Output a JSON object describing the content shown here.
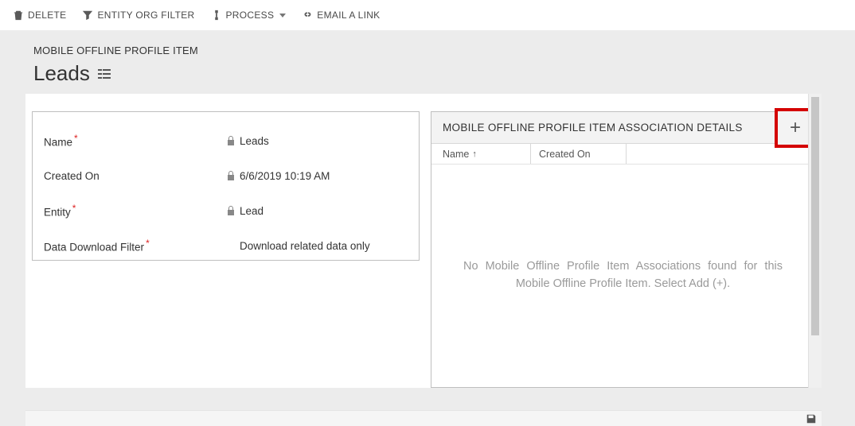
{
  "toolbar": {
    "delete": "DELETE",
    "filter": "ENTITY ORG FILTER",
    "process": "PROCESS",
    "email": "EMAIL A LINK"
  },
  "header": {
    "entity_label": "MOBILE OFFLINE PROFILE ITEM",
    "title": "Leads"
  },
  "form": {
    "name_label": "Name",
    "name_value": "Leads",
    "created_label": "Created On",
    "created_value": "6/6/2019  10:19 AM",
    "entity_label": "Entity",
    "entity_value": "Lead",
    "filter_label": "Data Download Filter",
    "filter_value": "Download related data only"
  },
  "assoc": {
    "panel_title": "MOBILE OFFLINE PROFILE ITEM ASSOCIATION DETAILS",
    "col_name": "Name",
    "col_created": "Created On",
    "empty": "No Mobile Offline Profile Item Associations found for this Mobile Offline Profile Item. Select Add (+)."
  }
}
